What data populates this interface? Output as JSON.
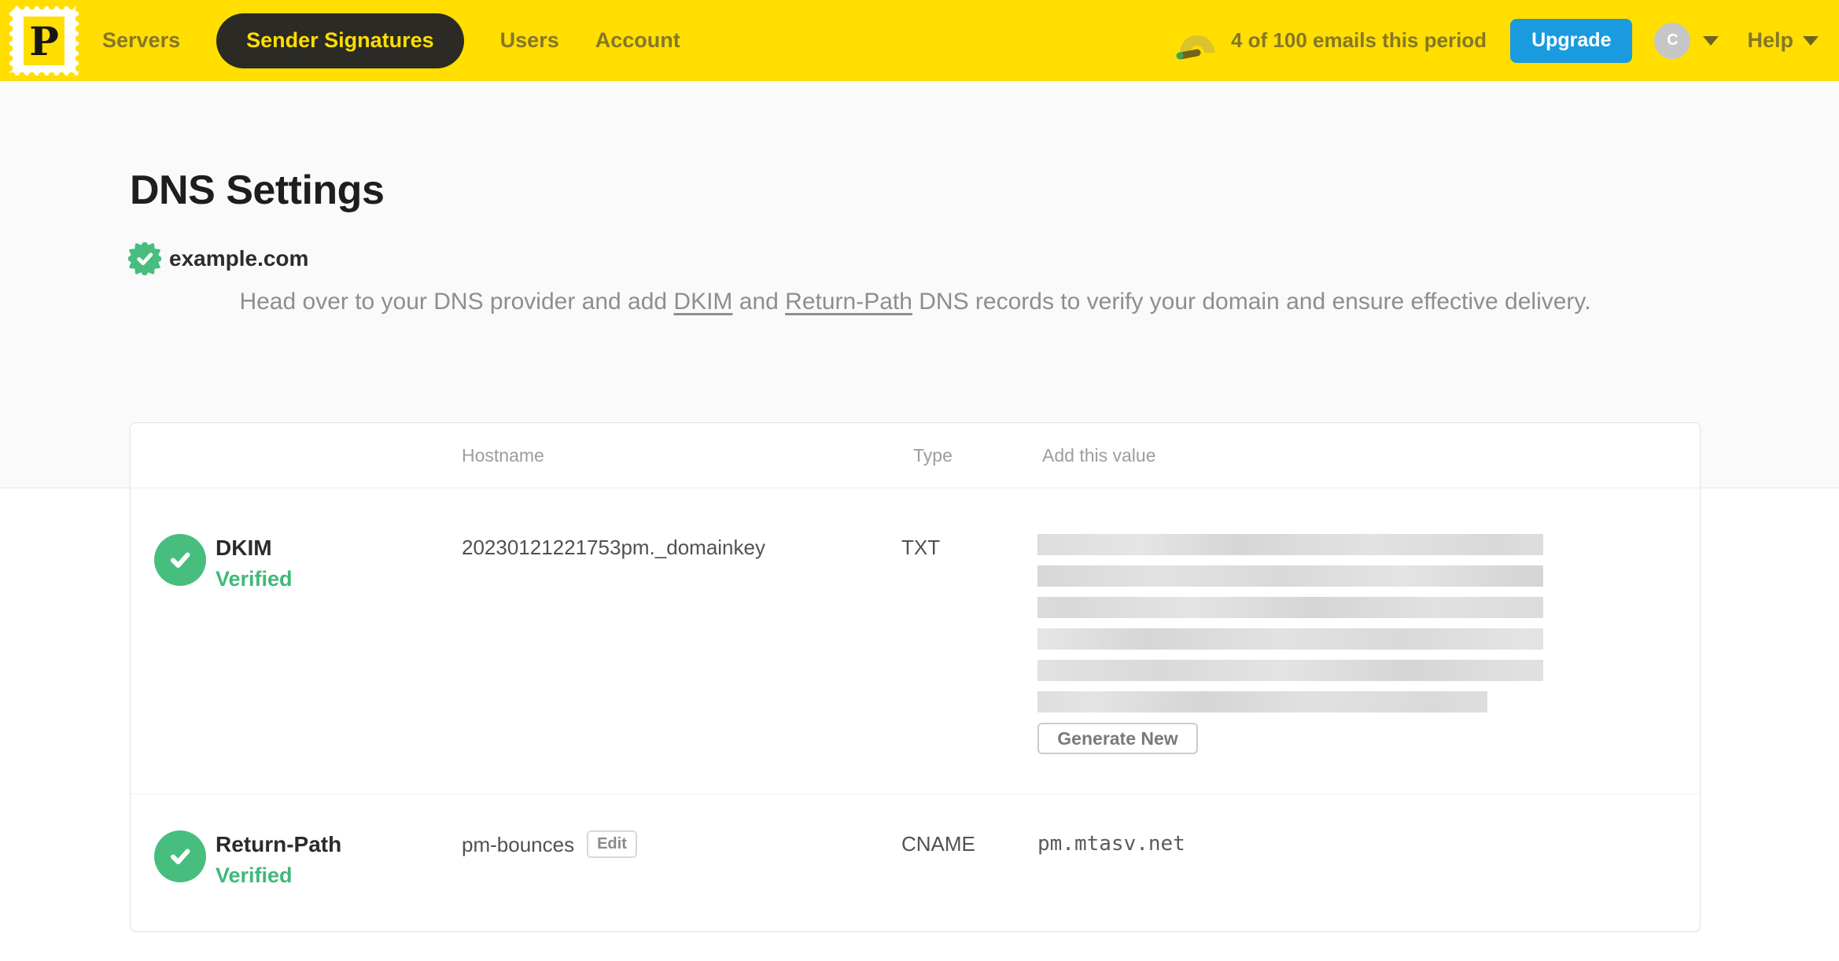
{
  "colors": {
    "brand_yellow": "#FFDE00",
    "nav_text": "#857727",
    "pill_bg": "#2B2A25",
    "caret_color": "#6E6320",
    "upgrade_blue": "#1A9BE0",
    "green": "#47BE7E",
    "green_text": "#3EBA78",
    "muted_text": "#8E8E8E"
  },
  "nav": {
    "logo_letter": "P",
    "items": [
      "Servers",
      "Sender Signatures",
      "Users",
      "Account"
    ],
    "active_item": "Sender Signatures",
    "usage_text": "4 of 100 emails this period",
    "upgrade_label": "Upgrade",
    "avatar_initial": "C",
    "help_label": "Help"
  },
  "page": {
    "title": "DNS Settings",
    "domain": "example.com",
    "description": {
      "part1": "Head over to your DNS provider and add ",
      "link1": "DKIM",
      "part2": " and ",
      "link2": "Return-Path",
      "part3": " DNS records to verify your domain and ensure effective delivery."
    }
  },
  "table": {
    "headers": {
      "hostname": "Hostname",
      "type": "Type",
      "value": "Add this value"
    },
    "rows": [
      {
        "name": "DKIM",
        "status": "Verified",
        "hostname": "20230121221753pm._domainkey",
        "type": "TXT",
        "value_redacted": true,
        "action_label": "Generate New"
      },
      {
        "name": "Return-Path",
        "status": "Verified",
        "hostname": "pm-bounces",
        "edit_label": "Edit",
        "type": "CNAME",
        "value": "pm.mtasv.net"
      }
    ]
  }
}
